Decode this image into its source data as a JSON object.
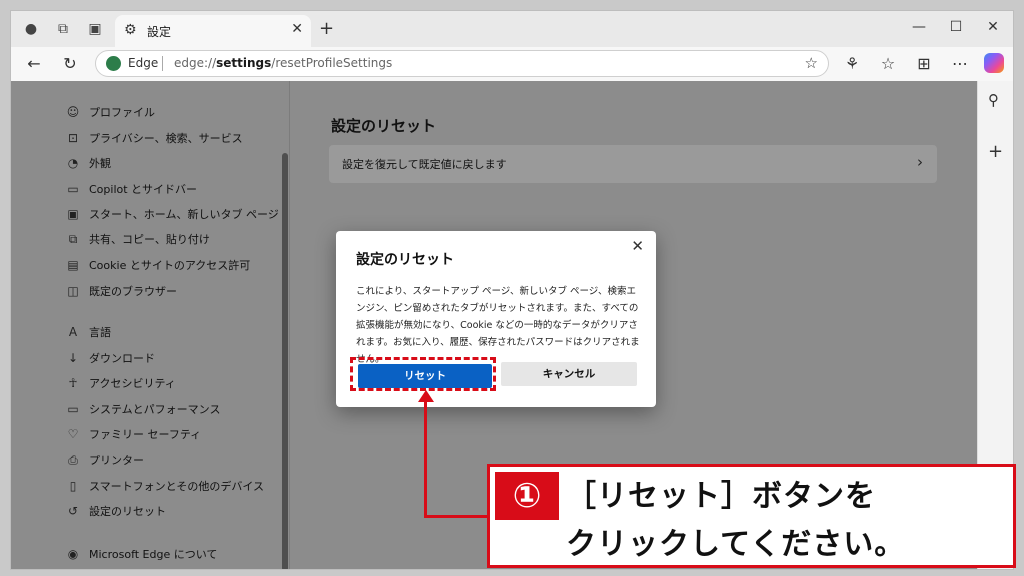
{
  "browser": {
    "tab_title": "設定",
    "tab_icon": "gear-icon",
    "omnibox": {
      "site_label": "Edge",
      "url_prefix": "edge://",
      "url_bold": "settings",
      "url_rest": "/resetProfileSettings"
    }
  },
  "sidebar": {
    "items": [
      {
        "icon": "profile-icon",
        "glyph": "☺",
        "label": "プロファイル"
      },
      {
        "icon": "lock-icon",
        "glyph": "⊡",
        "label": "プライバシー、検索、サービス"
      },
      {
        "icon": "appearance-icon",
        "glyph": "◔",
        "label": "外観"
      },
      {
        "icon": "sidebar-icon",
        "glyph": "▭",
        "label": "Copilot とサイドバー"
      },
      {
        "icon": "home-icon",
        "glyph": "▣",
        "label": "スタート、ホーム、新しいタブ ページ"
      },
      {
        "icon": "share-icon",
        "glyph": "⧉",
        "label": "共有、コピー、貼り付け"
      },
      {
        "icon": "cookie-icon",
        "glyph": "▤",
        "label": "Cookie とサイトのアクセス許可"
      },
      {
        "icon": "default-browser-icon",
        "glyph": "◫",
        "label": "既定のブラウザー"
      },
      {
        "icon": "language-icon",
        "glyph": "A",
        "label": "言語"
      },
      {
        "icon": "download-icon",
        "glyph": "↓",
        "label": "ダウンロード"
      },
      {
        "icon": "accessibility-icon",
        "glyph": "☥",
        "label": "アクセシビリティ"
      },
      {
        "icon": "performance-icon",
        "glyph": "▭",
        "label": "システムとパフォーマンス"
      },
      {
        "icon": "family-icon",
        "glyph": "♡",
        "label": "ファミリー セーフティ"
      },
      {
        "icon": "printer-icon",
        "glyph": "⎙",
        "label": "プリンター"
      },
      {
        "icon": "phone-icon",
        "glyph": "▯",
        "label": "スマートフォンとその他のデバイス"
      },
      {
        "icon": "reset-icon",
        "glyph": "↺",
        "label": "設定のリセット"
      },
      {
        "icon": "edge-icon",
        "glyph": "◉",
        "label": "Microsoft Edge について"
      }
    ]
  },
  "main": {
    "title": "設定のリセット",
    "row_label": "設定を復元して既定値に戻します"
  },
  "dialog": {
    "title": "設定のリセット",
    "body": "これにより、スタートアップ ページ、新しいタブ ページ、検索エンジン、ピン留めされたタブがリセットされます。また、すべての拡張機能が無効になり、Cookie などの一時的なデータがクリアされます。お気に入り、履歴、保存されたパスワードはクリアされません。",
    "reset_button": "リセット",
    "cancel_button": "キャンセル"
  },
  "callout": {
    "number": "①",
    "line1": "［リセット］ボタンを",
    "line2": "クリックしてください。"
  },
  "colors": {
    "accent": "#0a61c4",
    "highlight": "#d80c18"
  }
}
